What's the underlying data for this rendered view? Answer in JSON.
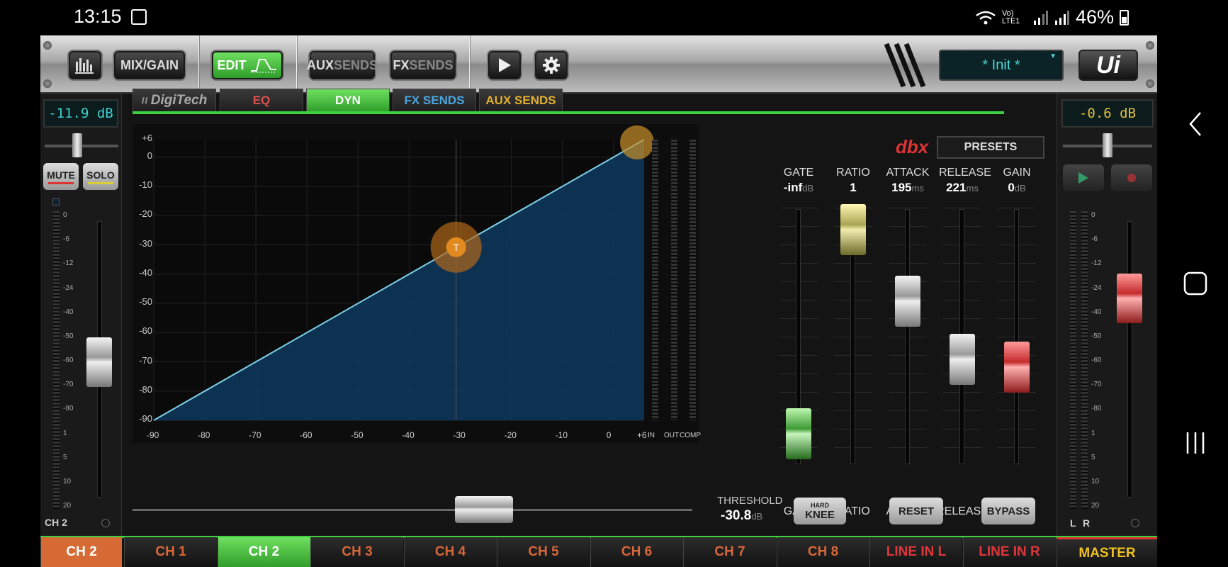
{
  "status_bar": {
    "time": "13:15",
    "signal_label": "Vo) LTE1",
    "battery": "46%"
  },
  "toolbar": {
    "mix_gain": "MIX/GAIN",
    "edit": "EDIT",
    "aux_a": "AUX",
    "aux_b": "SENDS",
    "fx_a": "FX",
    "fx_b": "SENDS",
    "preset_name": "* Init *",
    "logo": "Ui"
  },
  "left_strip": {
    "level": "-11.9 dB",
    "mute": "MUTE",
    "solo": "SOLO",
    "channel": "CH 2",
    "fader": 0.49
  },
  "right_strip": {
    "level": "-0.6 dB",
    "label_l": "L",
    "label_r": "R",
    "fader": 0.72
  },
  "tabs": {
    "brand": "DigiTech",
    "eq": "EQ",
    "dyn": "DYN",
    "fx": "FX SENDS",
    "aux": "AUX SENDS"
  },
  "graph": {
    "y_ticks": [
      "+6",
      "0",
      "-10",
      "-20",
      "-30",
      "-40",
      "-50",
      "-60",
      "-70",
      "-80",
      "-90"
    ],
    "x_ticks": [
      "-90",
      "-80",
      "-70",
      "-60",
      "-50",
      "-40",
      "-30",
      "-20",
      "-10",
      "0",
      "+6"
    ],
    "threshold_marker": "T",
    "meter_labels": [
      "IN",
      "OUT",
      "COMP"
    ],
    "threshold_label": "THRESHOLD",
    "threshold_value": "-30.8",
    "threshold_unit": "dB"
  },
  "dyn": {
    "brand": "dbx",
    "presets": "PRESETS",
    "params": [
      {
        "name": "GATE",
        "value": "-inf",
        "unit": "dB",
        "color": "#3d9b34",
        "level": 0.12
      },
      {
        "name": "RATIO",
        "value": "1",
        "unit": "",
        "color": "#a9a450",
        "level": 0.92
      },
      {
        "name": "ATTACK",
        "value": "195",
        "unit": "ms",
        "color": "#cccccc",
        "level": 0.64
      },
      {
        "name": "RELEASE",
        "value": "221",
        "unit": "ms",
        "color": "#cccccc",
        "level": 0.41
      },
      {
        "name": "GAIN",
        "value": "0",
        "unit": "dB",
        "color": "#c52c2c",
        "level": 0.38
      }
    ],
    "hard": "HARD",
    "knee": "KNEE",
    "reset": "RESET",
    "bypass": "BYPASS"
  },
  "meter_scale": [
    "0",
    "-6",
    "-12",
    "-24",
    "-40",
    "-50",
    "-60",
    "-70",
    "-80",
    "1",
    "5",
    "10",
    "20"
  ],
  "bottom": {
    "current": "CH 2",
    "channels": [
      "CH 1",
      "CH 2",
      "CH 3",
      "CH 4",
      "CH 5",
      "CH 6",
      "CH 7",
      "CH 8",
      "LINE IN L",
      "LINE IN R"
    ],
    "master": "MASTER"
  }
}
